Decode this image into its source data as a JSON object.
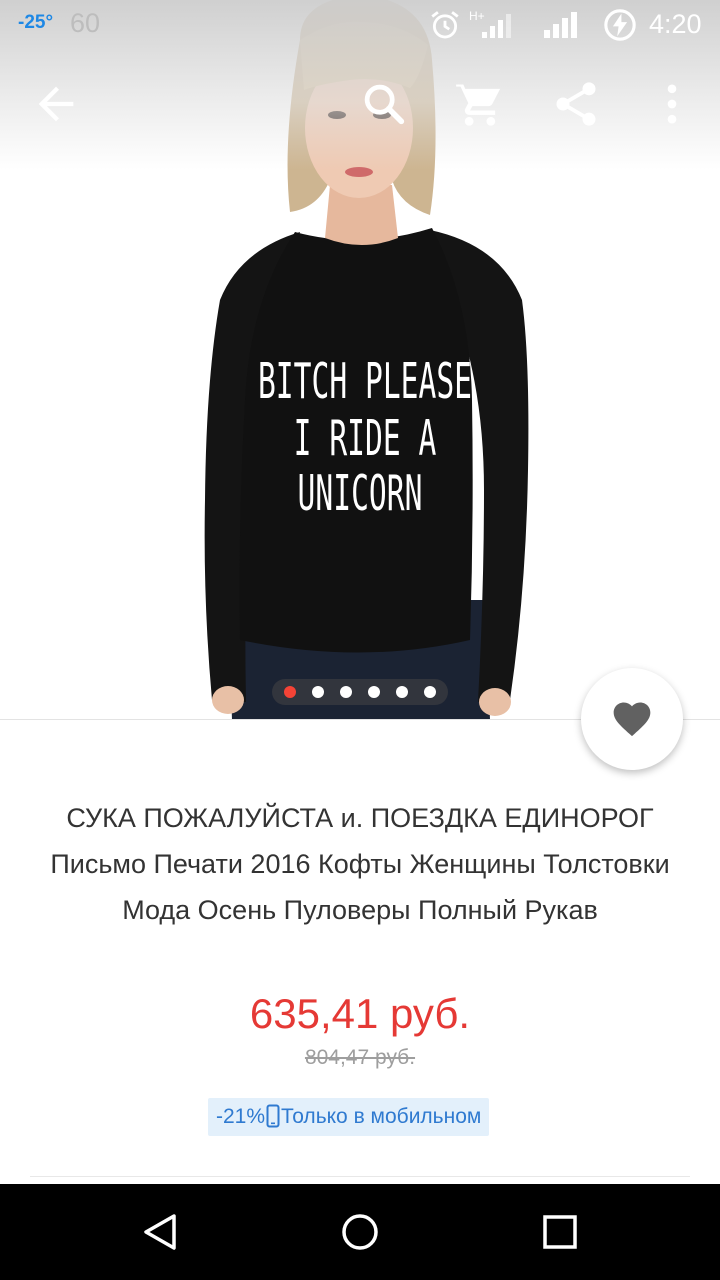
{
  "status_bar": {
    "temperature": "-25°",
    "notification_count": "60",
    "network_type": "H+",
    "time": "4:20"
  },
  "toolbar": {
    "back_icon": "arrow-back-icon",
    "search_icon": "search-icon",
    "cart_icon": "cart-icon",
    "share_icon": "share-icon",
    "more_icon": "more-vert-icon"
  },
  "product_image": {
    "print_lines": [
      "BITCH PLEASE",
      "I RIDE A",
      "UNICORN"
    ],
    "pager": {
      "total": 6,
      "active_index": 0
    }
  },
  "product": {
    "title": "СУКА ПОЖАЛУЙСТА и. ПОЕЗДКА ЕДИНОРОГ Письмо Печати 2016 Кофты Женщины Толстовки Мода Осень Пуловеры Полный Рукав",
    "price": "635,41 руб.",
    "old_price": "804,47 руб.",
    "discount": "-21%",
    "mobile_only": "Только в мобильном"
  },
  "colors": {
    "price": "#e53935",
    "promo_text": "#2f7ad0",
    "promo_bg": "#e3f0fb",
    "pager_active": "#f44336"
  }
}
